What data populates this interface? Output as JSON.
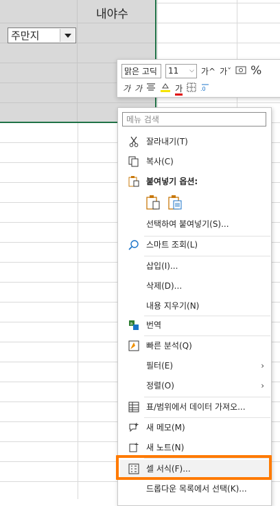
{
  "sheet": {
    "header_text": "내야수",
    "dropdown_value": "주만지"
  },
  "mini_toolbar": {
    "font_name": "맑은 고딕",
    "font_size": "11",
    "grow_font": "가^",
    "shrink_font": "가ˇ",
    "italic_a": "가",
    "italic_b": "가",
    "font_color_label": "가",
    "percent": "%"
  },
  "context_menu": {
    "search_placeholder": "메뉴 검색",
    "items": [
      {
        "label": "잘라내기(T)",
        "icon": "scissors-icon"
      },
      {
        "label": "복사(C)",
        "icon": "copy-icon"
      },
      {
        "label": "붙여넣기 옵션:",
        "icon": "paste-icon"
      },
      {
        "label": "선택하여 붙여넣기(S)...",
        "icon": ""
      },
      {
        "label": "스마트 조회(L)",
        "icon": "smart-lookup-icon"
      },
      {
        "label": "삽입(I)...",
        "icon": ""
      },
      {
        "label": "삭제(D)...",
        "icon": ""
      },
      {
        "label": "내용 지우기(N)",
        "icon": ""
      },
      {
        "label": "번역",
        "icon": "translate-icon"
      },
      {
        "label": "빠른 분석(Q)",
        "icon": "quick-analysis-icon"
      },
      {
        "label": "필터(E)",
        "icon": ""
      },
      {
        "label": "정렬(O)",
        "icon": ""
      },
      {
        "label": "표/범위에서 데이터 가져오...",
        "icon": "table-icon"
      },
      {
        "label": "새 메모(M)",
        "icon": "new-comment-icon"
      },
      {
        "label": "새 노트(N)",
        "icon": "new-note-icon"
      },
      {
        "label": "셀 서식(F)...",
        "icon": "format-cells-icon"
      },
      {
        "label": "드롭다운 목록에서 선택(K)...",
        "icon": ""
      }
    ],
    "submenu_arrow": "›"
  },
  "colors": {
    "highlight": "#ff7a00",
    "selection_border": "#1e7145",
    "selection_fill": "#d9d9d9"
  }
}
